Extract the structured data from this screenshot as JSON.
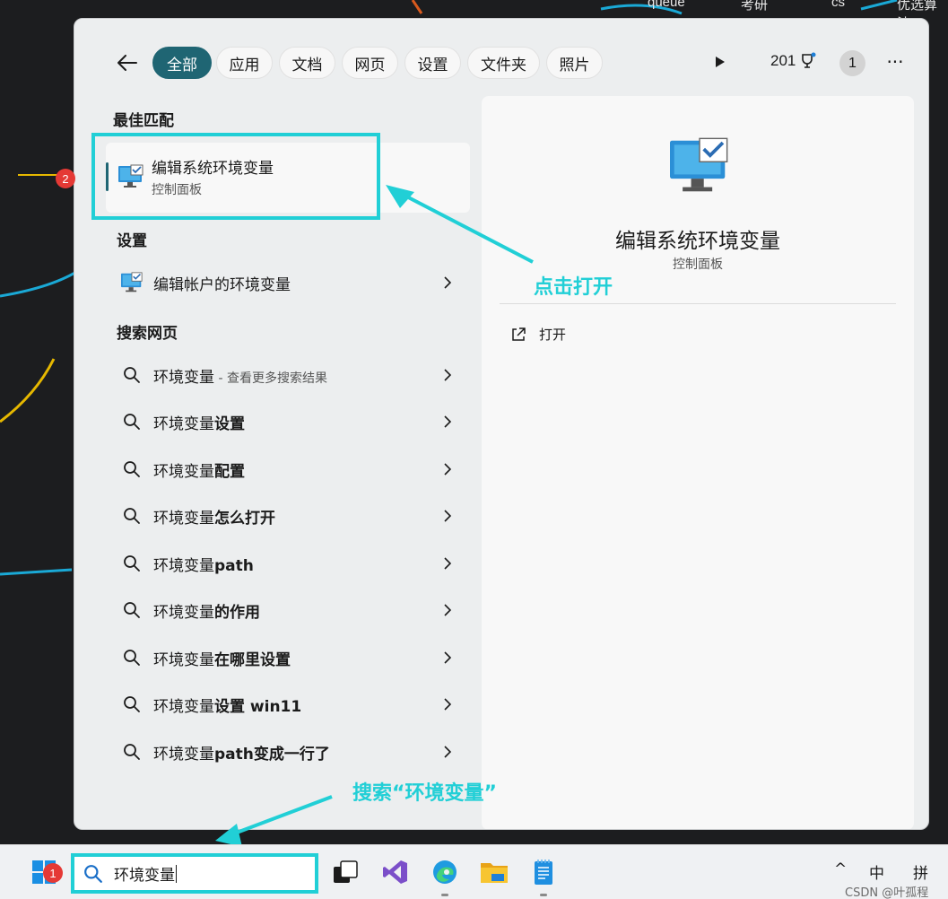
{
  "background": {
    "map_labels": [
      "queue",
      "考研",
      "cs",
      "优选算法"
    ]
  },
  "nav": {
    "back_icon": "arrow-left-icon",
    "filters": [
      "全部",
      "应用",
      "文档",
      "网页",
      "设置",
      "文件夹",
      "照片"
    ],
    "active_filter": "全部",
    "rewards_points": "201",
    "account_initial": "1",
    "more": "···"
  },
  "best_match": {
    "heading": "最佳匹配",
    "title": "编辑系统环境变量",
    "subtitle": "控制面板"
  },
  "settings": {
    "heading": "设置",
    "items": [
      {
        "label": "编辑帐户的环境变量"
      }
    ]
  },
  "web_search": {
    "heading": "搜索网页",
    "first": {
      "term": "环境变量",
      "suffix": " - 查看更多搜索结果"
    },
    "suggestions": [
      {
        "base": "环境变量",
        "bold": "设置"
      },
      {
        "base": "环境变量",
        "bold": "配置"
      },
      {
        "base": "环境变量",
        "bold": "怎么打开"
      },
      {
        "base": "环境变量",
        "bold": "path"
      },
      {
        "base": "环境变量",
        "bold": "的作用"
      },
      {
        "base": "环境变量",
        "bold": "在哪里设置"
      },
      {
        "base": "环境变量",
        "bold": "设置 win11"
      },
      {
        "base": "环境变量",
        "bold": "path变成一行了"
      }
    ]
  },
  "detail": {
    "title": "编辑系统环境变量",
    "subtitle": "控制面板",
    "action_open": "打开"
  },
  "annotations": {
    "click_open": "点击打开",
    "search_hint": "搜索“环境变量”",
    "badge_1": "1",
    "badge_2": "2"
  },
  "taskbar": {
    "search_value": "环境变量",
    "tray": {
      "chevron": "^",
      "ime_mode": "中",
      "ime_layout": "拼"
    },
    "watermark": "CSDN @叶孤程"
  },
  "colors": {
    "accent": "#1f6573",
    "annotation": "#21cfd6",
    "badge": "#e53935"
  }
}
